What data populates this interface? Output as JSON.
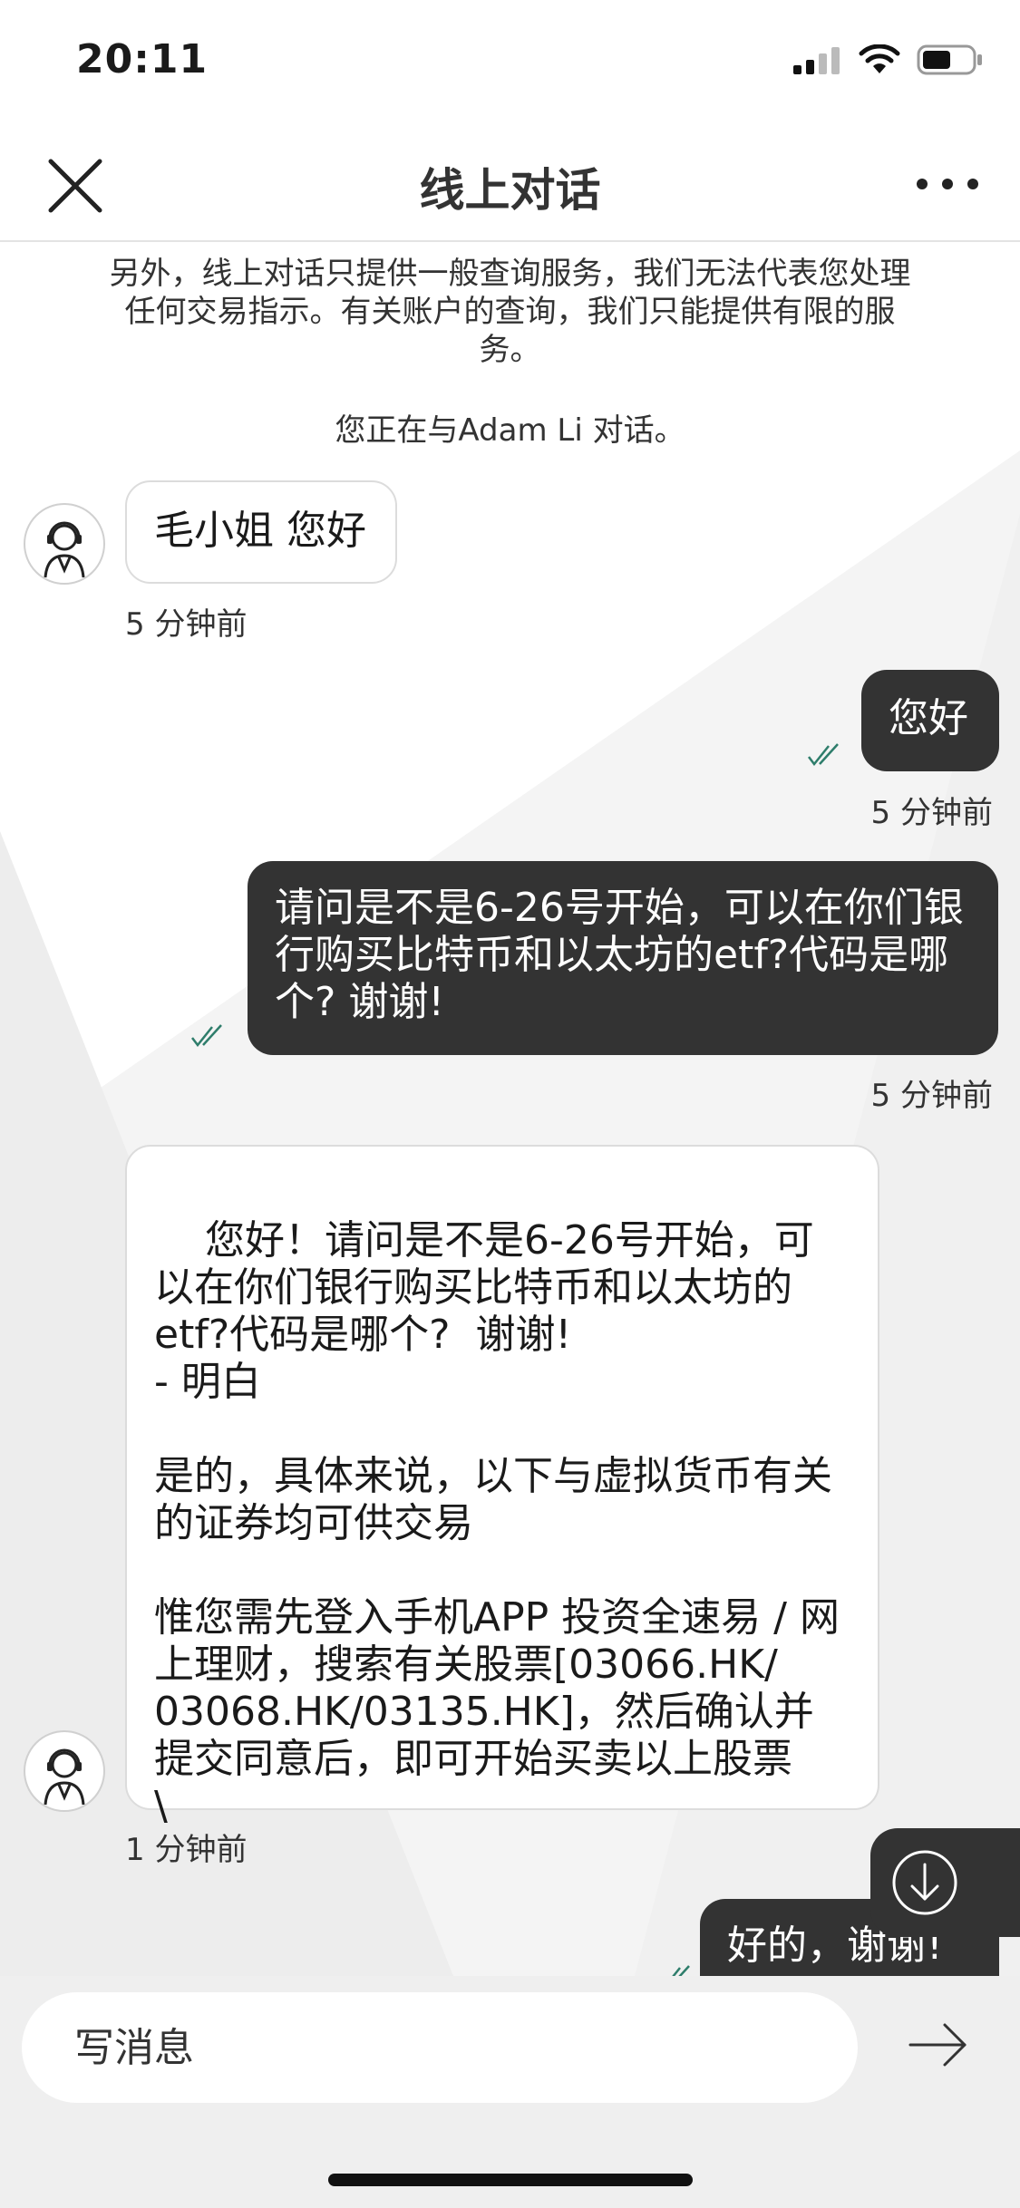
{
  "status_bar": {
    "time": "20:11"
  },
  "header": {
    "title": "线上对话",
    "more_label": "• • •"
  },
  "chat": {
    "notice": "另外，线上对话只提供一般查询服务，我们无法代表您处理任何交易指示。有关账户的查询，我们只能提供有限的服务。",
    "talking_to": "您正在与Adam Li 对话。",
    "messages": [
      {
        "sender": "agent",
        "text": "毛小姐 您好",
        "time": "5 分钟前"
      },
      {
        "sender": "user",
        "text": "您好",
        "time": "5 分钟前"
      },
      {
        "sender": "user",
        "text": "请问是不是6-26号开始，可以在你们银行购买比特币和以太坊的etf?代码是哪个?  谢谢!",
        "time": "5 分钟前"
      },
      {
        "sender": "agent",
        "text": "您好！请问是不是6-26号开始，可以在你们银行购买比特币和以太坊的etf?代码是哪个?  谢谢!\n- 明白\n\n是的，具体来说，以下与虚拟货币有关的证券均可供交易\n\n惟您需先登入手机APP 投资全速易 / 网上理财，搜索有关股票[03066.HK/ 03068.HK/03135.HK]，然后确认并提交同意后，即可开始买卖以上股票\n\\",
        "time": "1 分钟前"
      },
      {
        "sender": "user",
        "text": "好的，谢谢!",
        "time": ""
      }
    ]
  },
  "input": {
    "placeholder": "写消息"
  },
  "colors": {
    "user_bubble": "#333333",
    "agent_bubble_border": "#dcdcdc",
    "check_green": "#2e7d6b"
  }
}
